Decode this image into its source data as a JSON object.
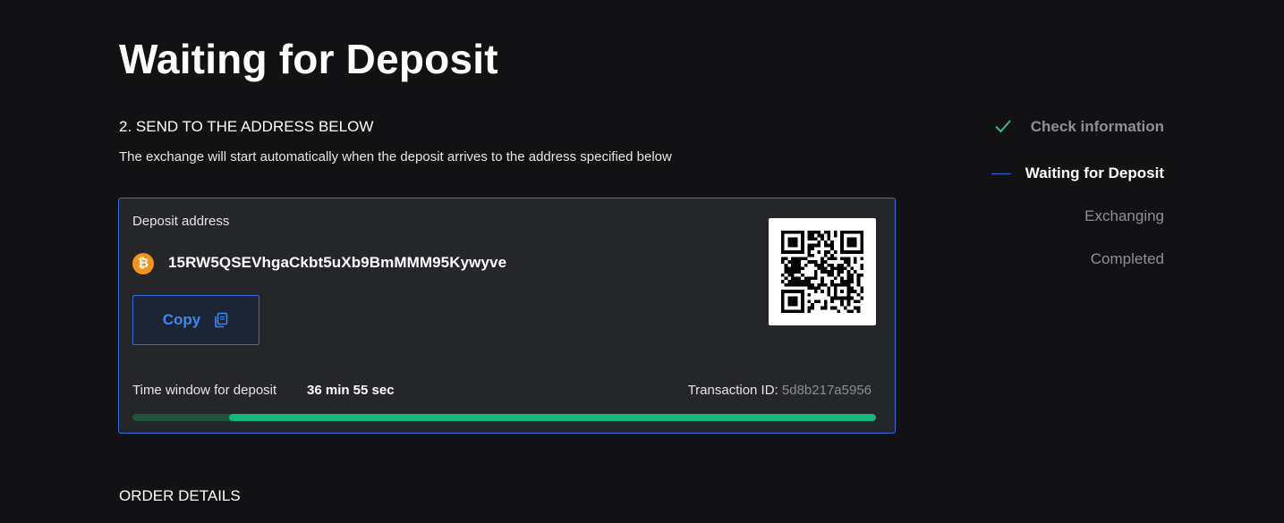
{
  "page": {
    "title": "Waiting for Deposit"
  },
  "send_section": {
    "heading": "2. SEND TO THE ADDRESS BELOW",
    "subtitle": "The exchange will start automatically when the deposit arrives to the address specified below"
  },
  "deposit": {
    "label": "Deposit address",
    "coin_icon": "bitcoin-icon",
    "coin_glyph": "₿",
    "address": "15RW5QSEVhgaCkbt5uXb9BmMMM95Kywyve",
    "copy_label": "Copy",
    "copy_icon": "copy-icon",
    "qr_icon": "qr-code",
    "time_label": "Time window for deposit",
    "time_value": "36 min 55 sec",
    "tx_label": "Transaction ID:",
    "tx_value": "5d8b217a5956",
    "time_remaining_fraction": 0.87
  },
  "order_details": {
    "heading": "ORDER DETAILS"
  },
  "steps": [
    {
      "label": "Check information",
      "state": "done",
      "icon": "check-icon"
    },
    {
      "label": "Waiting for Deposit",
      "state": "active"
    },
    {
      "label": "Exchanging",
      "state": "pending"
    },
    {
      "label": "Completed",
      "state": "pending"
    }
  ],
  "colors": {
    "background": "#121215",
    "card": "#25262a",
    "accent_blue": "#2f6ed8",
    "progress_green": "#13b97a",
    "progress_track": "#20523e",
    "check_green": "#3dbb72",
    "bitcoin_orange": "#f7931a"
  }
}
